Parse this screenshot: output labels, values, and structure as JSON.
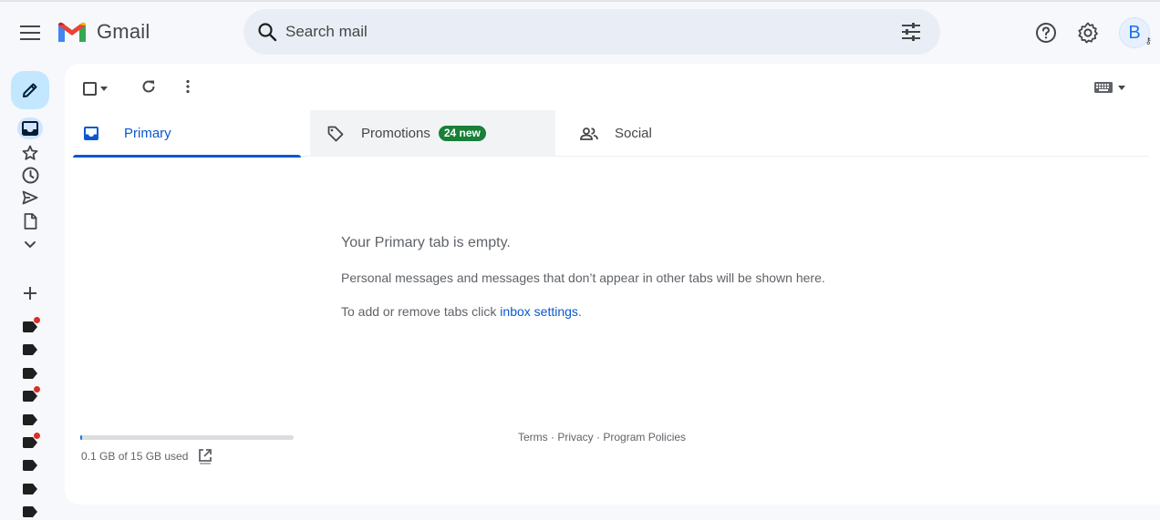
{
  "app": {
    "name": "Gmail"
  },
  "search": {
    "placeholder": "Search mail"
  },
  "header": {
    "avatar_letter": "B"
  },
  "tabs": [
    {
      "label": "Primary",
      "active": true
    },
    {
      "label": "Promotions",
      "badge": "24 new"
    },
    {
      "label": "Social"
    }
  ],
  "empty_state": {
    "title": "Your Primary tab is empty.",
    "line1": "Personal messages and messages that don’t appear in other tabs will be shown here.",
    "line2_prefix": "To add or remove tabs click ",
    "line2_link": "inbox settings",
    "line2_suffix": "."
  },
  "storage": {
    "text": "0.1 GB of 15 GB used",
    "fraction": 0.007
  },
  "footer": {
    "terms": "Terms",
    "sep1": " · ",
    "privacy": "Privacy",
    "sep2": " · ",
    "policies": "Program Policies"
  },
  "labels": [
    {
      "name": "label-1",
      "has_dot": true
    },
    {
      "name": "label-2",
      "has_dot": false
    },
    {
      "name": "label-3",
      "has_dot": false
    },
    {
      "name": "label-4",
      "has_dot": true
    },
    {
      "name": "label-5",
      "has_dot": false
    },
    {
      "name": "label-6",
      "has_dot": true
    },
    {
      "name": "label-7",
      "has_dot": false
    },
    {
      "name": "label-8",
      "has_dot": false
    },
    {
      "name": "label-9",
      "has_dot": false
    }
  ],
  "colors": {
    "accent": "#0b57d0",
    "compose_bg": "#c2e7ff",
    "badge_green": "#188038",
    "label_dot": "#d93025"
  }
}
